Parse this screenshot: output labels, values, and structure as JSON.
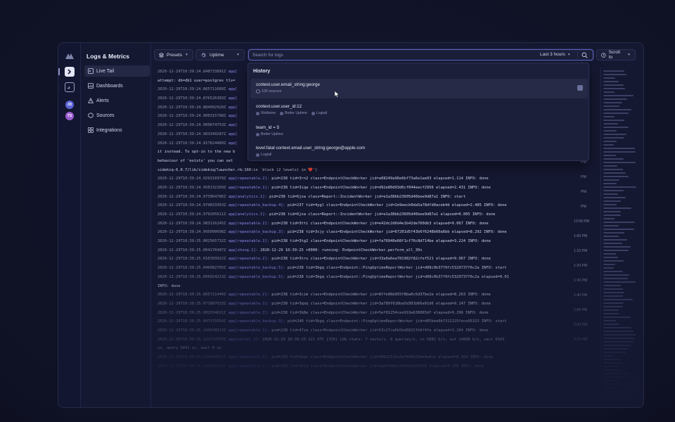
{
  "app": {
    "title": "Logs & Metrics"
  },
  "rail": {
    "avatars": [
      {
        "initials": "JD",
        "color": "#5a63d6"
      },
      {
        "initials": "TS",
        "color": "#9a5bd1"
      }
    ]
  },
  "nav": {
    "items": [
      {
        "label": "Live Tail",
        "icon": "terminal-icon",
        "active": true
      },
      {
        "label": "Dashboards",
        "icon": "chart-icon"
      },
      {
        "label": "Alerts",
        "icon": "warning-icon"
      },
      {
        "label": "Sources",
        "icon": "sources-icon"
      },
      {
        "label": "Integrations",
        "icon": "grid-icon"
      }
    ]
  },
  "toolbar": {
    "presets_label": "Presets",
    "uptime_label": "Uptime",
    "search_placeholder": "Search for logs",
    "range_label": "Last 3 hours",
    "scroll_label": "Scroll to"
  },
  "history": {
    "title": "History",
    "entries": [
      {
        "query": "context.user.email_string:george",
        "tags": [
          "100 sources"
        ],
        "highlighted": true
      },
      {
        "query": "context.user.user_id:12",
        "tags": [
          "Wallmine",
          "Better Uptime",
          "Logtail"
        ]
      },
      {
        "query": "team_id = 5",
        "tags": [
          "Better Uptime"
        ]
      },
      {
        "query": "level:fatal context.email.user_string:george@apple.com",
        "tags": [
          "Logtail"
        ]
      }
    ]
  },
  "logs": [
    {
      "ts": "2020-12-29T10:39:24.848733891Z",
      "ctx": "app[",
      "msg": ""
    },
    {
      "ts": "",
      "ctx": "",
      "msg": "attempt: db=db1 user=postgres tls="
    },
    {
      "ts": "2020-12-29T10:39:24.865711689Z",
      "ctx": "app[",
      "msg": ""
    },
    {
      "ts": "2020-12-29T10:39:24.876526383Z",
      "ctx": "app[",
      "msg": ""
    },
    {
      "ts": "2020-12-29T10:39:24.884092928Z",
      "ctx": "app[",
      "msg": ""
    },
    {
      "ts": "2020-12-29T10:39:24.900315798Z",
      "ctx": "app[",
      "msg": ""
    },
    {
      "ts": "2020-12-29T10:39:24.900874753Z",
      "ctx": "app[",
      "msg": ""
    },
    {
      "ts": "2020-12-29T10:39:24.903349287Z",
      "ctx": "app[",
      "msg": ""
    },
    {
      "ts": "2020-12-29T10:39:24.917824489Z",
      "ctx": "app[",
      "msg": ""
    },
    {
      "ts": "",
      "ctx": "",
      "msg": "it instead. To opt-in to the new b"
    },
    {
      "ts": "",
      "ctx": "",
      "msg": "behaviour of 'exists' you can set"
    },
    {
      "ts": "",
      "ctx": "",
      "msg": "sidekiq-6.0.7/lib/sidekiq/launcher.rb:160:in `block (2 levels) in ❤️')"
    },
    {
      "ts": "2020-12-29T10:39:24.929316979Z",
      "ctx": "app[repeatable.2]:",
      "msg": " pid=238 tid=3rn2 class=EndpointCheckWorker jid=a08249a96e6bf73a6e1ae03 elapsed=1.114 INFO: done"
    },
    {
      "ts": "2020-12-29T10:39:24.950132169Z",
      "ctx": "app[repeatable.1]:",
      "msg": " pid=238 tid=3iqa class=EndpointCheckWorker jid=d92e80d93d6cf044eecf2956 elapsed=2.431 INFO: done"
    },
    {
      "ts": "2020-12-29T10:39:24.973964786Z",
      "ctx": "app[analytics.1]:",
      "msg": " pid=238 tid=6jxa class=Report::IncidentWorker jid=e1a38bb23605d46bee9d87a1 INFO: start"
    },
    {
      "ts": "2020-12-29T10:39:24.974833363Z",
      "ctx": "app[repeatable_backup.4]:",
      "msg": " pid=237 tid=4ygl class=EndpointCheckWorker jid=2e9eecb0da5a78dfd0aceb4d elapsed=2.485 INFO: done"
    },
    {
      "ts": "2020-12-29T10:39:24.979265611Z",
      "ctx": "app[analytics.1]:",
      "msg": " pid=238 tid=6jxa class=Report::IncidentWorker jid=e1a38bb23605d46bee9d87a1 elapsed=0.005 INFO: done"
    },
    {
      "ts": "2020-12-29T10:39:24.983116245Z",
      "ctx": "app[repeatable.2]:",
      "msg": " pid=238 tid=3tti class=EndpointCheckWorker jid=e42dc2d6d4e1b42de760db3 elapsed=9.067 INFO: done"
    },
    {
      "ts": "2020-12-29T10:39:24.995099698Z",
      "ctx": "app[repeatable_backup.3]:",
      "msg": " pid=238 tid=3cjy class=EndpointCheckWorker jid=67201d5f43b6f6248b60a6bb elapsed=8.292 INFO: done"
    },
    {
      "ts": "2020-12-29T10:39:25.002565732Z",
      "ctx": "app[repeatable.2]:",
      "msg": " pid=238 tid=3tg2 class=EndpointCheckWorker jid=fa76940e68f1cf76c8d714be elapsed=3.224 INFO: done"
    },
    {
      "ts": "2020-12-29T10:39:25.004170487Z",
      "ctx": "app[zhong.1]:",
      "msg": " 2020-12-29 10:39:25 +0000: running: EndpointCheckWorker.perform_all_30s"
    },
    {
      "ts": "2020-12-29T10:39:25.016393922Z",
      "ctx": "app[repeatable.2]:",
      "msg": " pid=238 tid=3tru class=EndpointCheckWorker jid=33a0a6ea781982f82cfef521 elapsed=9.967 INFO: done"
    },
    {
      "ts": "2020-12-29T10:39:25.046082765Z",
      "ctx": "app[repeatable_backup.5]:",
      "msg": " pid=238 tid=3bgq class=Endpoint::PingUptimeReportWorker jid=d08c0b37f9fc5329737f6c2a INFO: start"
    },
    {
      "ts": "2020-12-29T10:39:25.056924213Z",
      "ctx": "app[repeatable_backup.5]:",
      "msg": " pid=238 tid=3bgq class=Endpoint::PingUptimeReportWorker jid=d08c0b37f9fc5329737f6c2a elapsed=0.01"
    },
    {
      "ts": "",
      "ctx": "",
      "msg": "INFO: done"
    },
    {
      "ts": "2020-12-29T10:39:25.065721440Z",
      "ctx": "app[repeatable.2]:",
      "msg": " pid=238 tid=3cim class=EndpointCheckWorker jid=8ffe96b955f8ba0c5d37be1e elapsed=8.263 INFO: done"
    },
    {
      "ts": "2020-12-29T10:39:25.071887633Z",
      "ctx": "app[repeatable.1]:",
      "msg": " pid=238 tid=3qoq class=EndpointCheckWorker jid=3a789f018ba5d301b66a91d6 elapsed=9.147 INFO: done"
    },
    {
      "ts": "2020-12-29T10:39:25.082034021Z",
      "ctx": "app[repeatable.2]:",
      "msg": " pid=238 tid=3b8e class=EndpointCheckWorker jid=5ef01254cee919a630865df elapsed=9.296 INFO: done"
    },
    {
      "ts": "2020-12-29T10:39:25.097375654Z",
      "ctx": "app[repeatable_backup.3]:",
      "msg": " pid=240 tid=3bgq class=Endpoint::PingUptimeReportWorker jid=d05bee0b7312125fece95323 INFO: start"
    },
    {
      "ts": "2020-12-29T10:39:25.104038013Z",
      "ctx": "app[repeatable.1]:",
      "msg": " pid=238 tid=47za class=EndpointCheckWorker jid=53c27ca6b5bd6815fb6f4fe elapsed=3.264 INFO: done"
    },
    {
      "ts": "2020-12-29T10:39:25.121713755Z",
      "ctx": "app[server.1]:",
      "msg": " 2020-12-29 10:39:25.121 UTC [335] LOG stats: 7 xacts/s, 8 queries/s, in 5882 b/s, out 14898 b/s, xact 6343"
    },
    {
      "ts": "",
      "ctx": "",
      "msg": "us, query 5841 us, wait 0 us"
    },
    {
      "ts": "2020-12-29T10:39:25.134040097Z",
      "ctx": "app[repeatable.2]:",
      "msg": " pid=238 tid=3ewn class=EndpointCheckWorker jid=49b22126a3af448b284e4a4ca elapsed=8.264 INFO: done"
    },
    {
      "ts": "2020-12-29T10:39:25.140036611Z",
      "ctx": "app[repeatable.1]:",
      "msg": " pid=238 tid=3h1q class=EndpointCheckWorker jid=4ae0f8b6c20e43a1d7b95 elapsed=9.208 INFO: done"
    }
  ],
  "timeline": [
    "PM",
    "PM",
    "PM",
    "PM",
    "PM",
    "PM",
    "PM",
    "PM",
    "PM",
    "PM",
    "12:50 PM",
    "1:00 PM",
    "1:10 PM",
    "1:20 PM",
    "1:30 PM",
    "1:40 PM",
    "1:50 PM",
    "2:00 PM",
    "2:10 PM"
  ]
}
